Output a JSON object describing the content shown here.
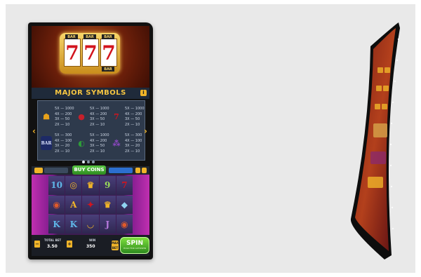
{
  "game": {
    "logo_reels": [
      "7",
      "7",
      "7"
    ],
    "logo_chips": [
      "BAR",
      "BAR",
      "BAR",
      "BAR"
    ],
    "paytable_title": "MAJOR SYMBOLS",
    "info_label": "i",
    "arrow_left": "‹",
    "arrow_right": "›",
    "symbols": [
      {
        "icon": "bell-icon",
        "glyph": "☗",
        "color": "#e8a21a",
        "pays": "5X — 1000\n4X — 200\n3X — 50\n2X — 10"
      },
      {
        "icon": "strawberry-icon",
        "glyph": "●",
        "color": "#c6202b",
        "pays": "5X — 1000\n4X — 200\n3X — 50\n2X — 10"
      },
      {
        "icon": "seven-icon",
        "glyph": "7",
        "color": "#d2141e",
        "pays": "5X — 1000\n4X — 200\n3X — 50\n2X — 10"
      },
      {
        "icon": "bar-icon",
        "glyph": "BAR",
        "color": "#5b6bd8",
        "pays": "5X — 300\n4X — 100\n3X — 20\n2X — 10"
      },
      {
        "icon": "watermelon-icon",
        "glyph": "◐",
        "color": "#2e9b3a",
        "pays": "5X — 1000\n4X — 200\n3X — 50\n2X — 10"
      },
      {
        "icon": "grapes-icon",
        "glyph": "⁂",
        "color": "#6b2ca3",
        "pays": "5X — 300\n4X — 100\n3X — 20\n2X — 10"
      }
    ],
    "buy_coins_label": "BUY COINS",
    "reel_symbols": [
      "10",
      "◎",
      "♛",
      "9",
      "7",
      "◉",
      "A",
      "✦",
      "♛",
      "◆",
      "K",
      "K",
      "◡",
      "J",
      "◉"
    ],
    "reel_colors": [
      "#5fb7e8",
      "#f0b429",
      "#f0b429",
      "#9bdc5a",
      "#d2141e",
      "#e05a2a",
      "#f0b429",
      "#d2141e",
      "#f0b429",
      "#8fd3f0",
      "#5fb7e8",
      "#5fb7e8",
      "#f0b429",
      "#b87adf",
      "#e05a2a"
    ],
    "total_bet_label": "TOTAL BET",
    "total_bet_value": "3.50",
    "win_label": "WIN",
    "win_value": "350",
    "max_bet_label": "MAX BET",
    "spin_label": "SPIN",
    "spin_sub": "HOLD FOR AUTOSPIN",
    "minus_label": "−",
    "plus_label": "+"
  }
}
